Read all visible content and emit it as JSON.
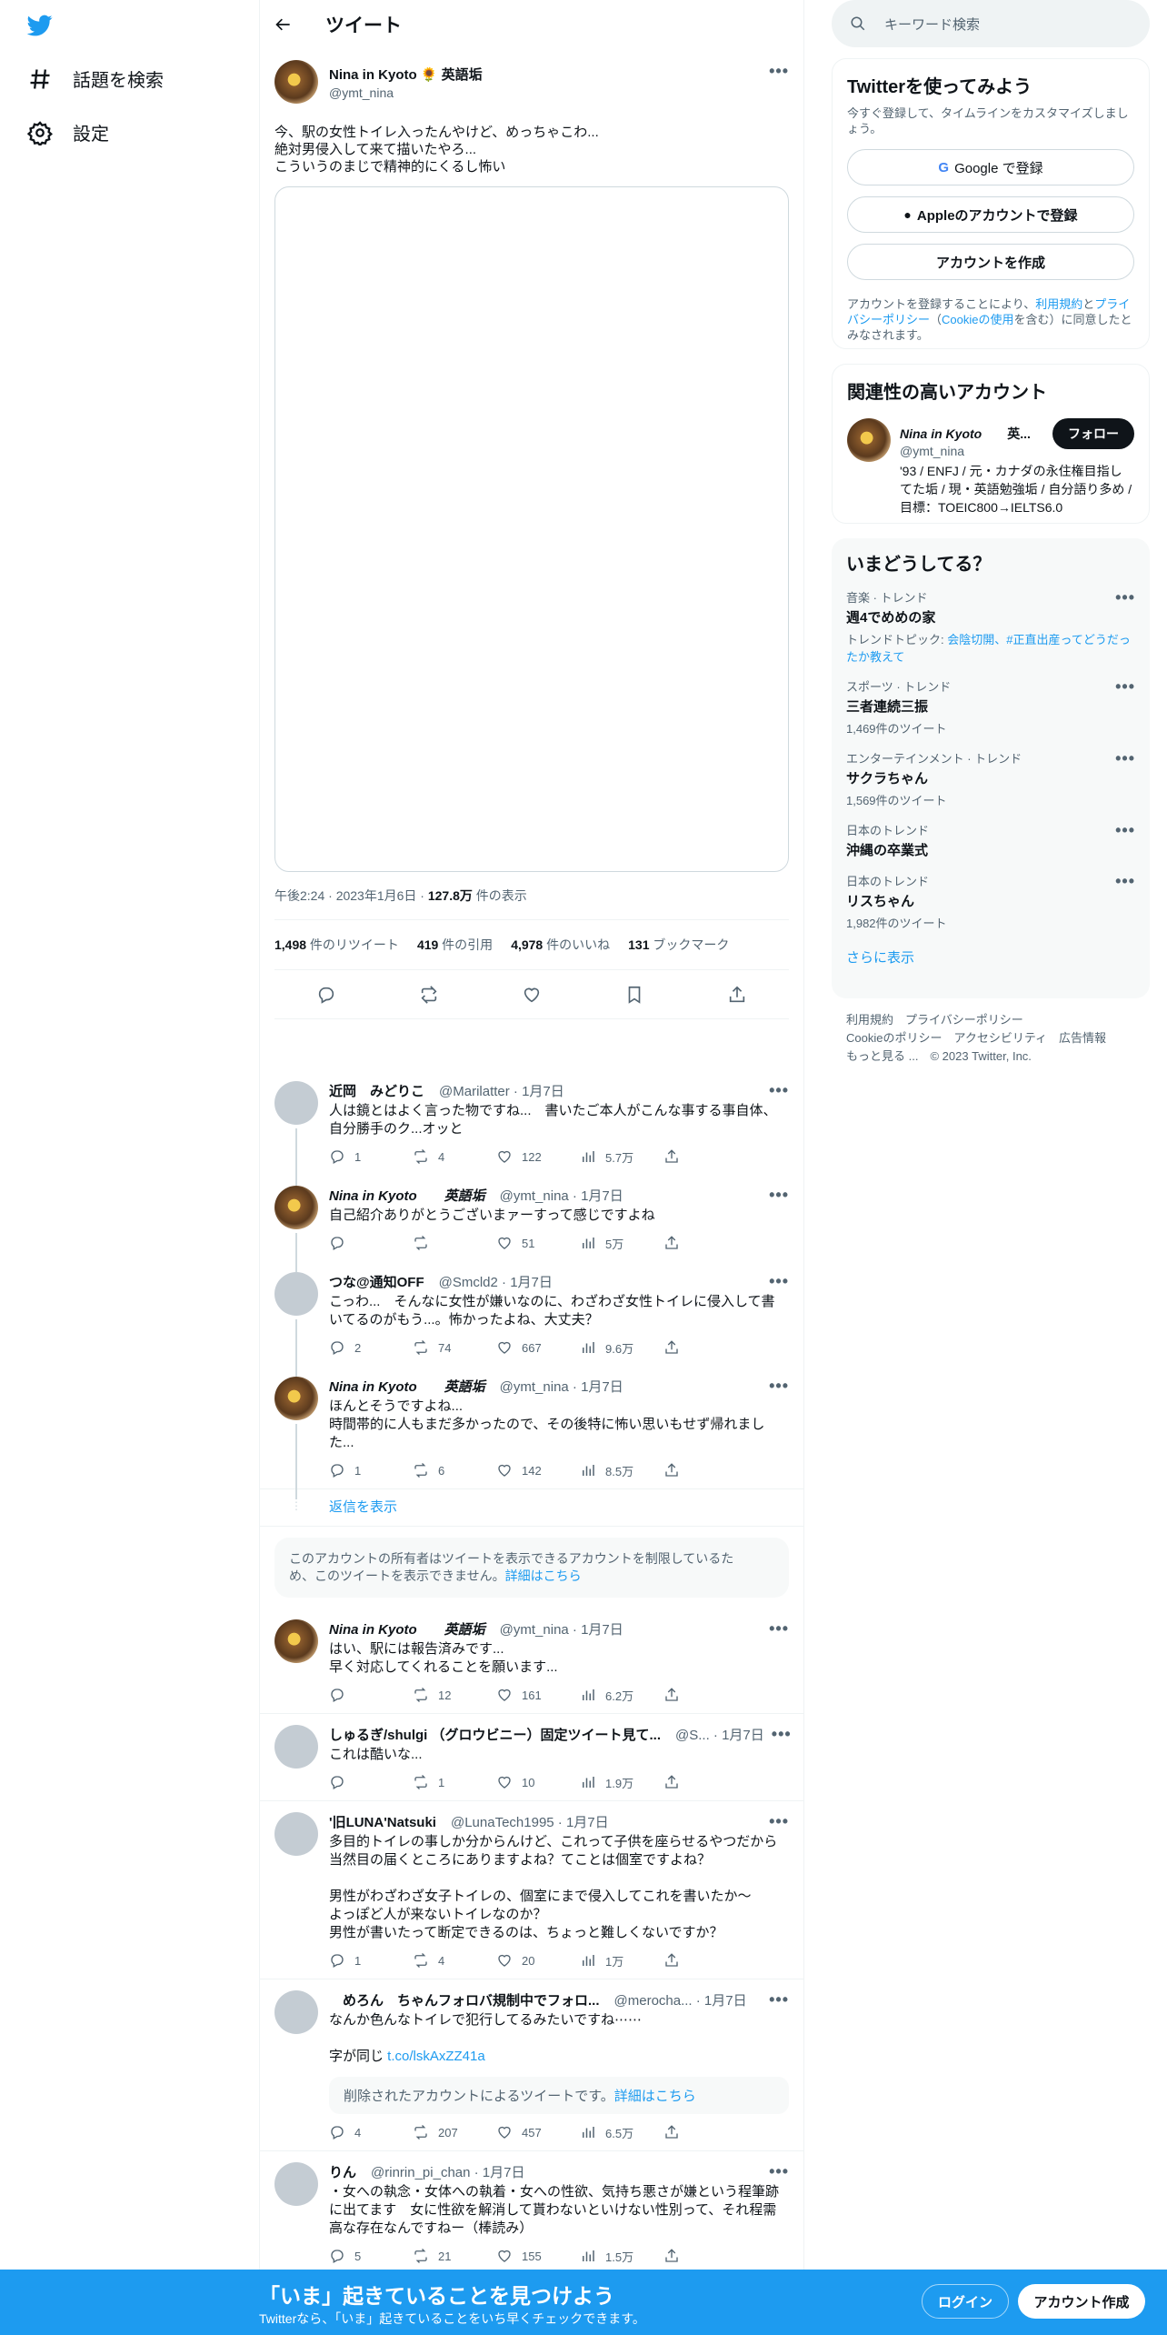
{
  "nav": {
    "explore": "話題を検索",
    "settings": "設定"
  },
  "header": {
    "title": "ツイート"
  },
  "tweet": {
    "name": "Nina in Kyoto 🌻 英語垢",
    "handle": "@ymt_nina",
    "lines": [
      "今、駅の女性トイレ入ったんやけど、めっちゃこわ...",
      "絶対男侵入して来て描いたやろ...",
      "こういうのまじで精神的にくるし怖い"
    ],
    "time": "午後2:24 · 2023年1月6日 · ",
    "views": "127.8万",
    "views_label": " 件の表示",
    "stats": [
      {
        "n": "1,498",
        "l": " 件のリツイート"
      },
      {
        "n": "419",
        "l": " 件の引用"
      },
      {
        "n": "4,978",
        "l": " 件のいいね"
      },
      {
        "n": "131",
        "l": " ブックマーク"
      }
    ]
  },
  "replies": [
    {
      "name": "近岡　みどりこ",
      "handle": "@Marilatter · 1月7日",
      "text": [
        "人は鏡とはよく言った物ですね...　書いたご本人がこんな事する事自体、",
        "自分勝手のク...オッと"
      ],
      "c": "1",
      "r": "4",
      "l": "122",
      "v": "5.7万"
    },
    {
      "name": "Nina in Kyoto　　英語垢",
      "handle": "@ymt_nina · 1月7日",
      "text": [
        "自己紹介ありがとうございまァーすって感じですよね"
      ],
      "c": "",
      "r": "",
      "l": "51",
      "v": "5万"
    },
    {
      "name": "つな@通知OFF",
      "handle": "@Smcld2 · 1月7日",
      "text": [
        "こっわ...　そんなに女性が嫌いなのに、わざわざ女性トイレに侵入して書",
        "いてるのがもう...。怖かったよね、大丈夫？"
      ],
      "c": "2",
      "r": "74",
      "l": "667",
      "v": "9.6万"
    },
    {
      "name": "Nina in Kyoto　　英語垢",
      "handle": "@ymt_nina · 1月7日",
      "text": [
        "ほんとそうですよね...",
        "時間帯的に人もまだ多かったので、その後特に怖い思いもせず帰れまし",
        "た..."
      ],
      "c": "1",
      "r": "6",
      "l": "142",
      "v": "8.5万"
    }
  ],
  "show_replies": "返信を表示",
  "restricted": {
    "text": "このアカウントの所有者はツイートを表示できるアカウントを制限しているた",
    "text2": "め、このツイートを表示できません。",
    "link": "詳細はこちら"
  },
  "replies2": [
    {
      "name": "Nina in Kyoto　　英語垢",
      "handle": "@ymt_nina · 1月7日",
      "text": [
        "はい、駅には報告済みです...",
        "早く対応してくれることを願います..."
      ],
      "c": "",
      "r": "12",
      "l": "161",
      "v": "6.2万"
    },
    {
      "name": "しゅるぎ/shulgi （グロウビニー）固定ツイート見て...",
      "handle": "@S... · 1月7日",
      "text": [
        "これは酷いな..."
      ],
      "c": "",
      "r": "1",
      "l": "10",
      "v": "1.9万"
    },
    {
      "name": "'旧LUNA'Natsuki",
      "handle": "@LunaTech1995 · 1月7日",
      "text": [
        "多目的トイレの事しか分からんけど、これって子供を座らせるやつだから",
        "当然目の届くところにありますよね？てことは個室ですよね？",
        "",
        "男性がわざわざ女子トイレの、個室にまで侵入してこれを書いたか～",
        "よっぽど人が来ないトイレなのか？",
        "男性が書いたって断定できるのは、ちょっと難しくないですか？"
      ],
      "c": "1",
      "r": "4",
      "l": "20",
      "v": "1万"
    },
    {
      "name": "　めろん　ちゃんフォロバ規制中でフォロ...",
      "handle": "@merocha... · 1月7日",
      "text": [
        "なんか色んなトイレで犯行してるみたいですね⋯⋯",
        "",
        "字が同じ "
      ],
      "link": "t.co/lskAxZZ41a",
      "deleted": "削除されたアカウントによるツイートです。",
      "deleted_link": "詳細はこちら",
      "c": "4",
      "r": "207",
      "l": "457",
      "v": "6.5万"
    },
    {
      "name": "りん",
      "handle": "@rinrin_pi_chan · 1月7日",
      "text": [
        "・女への執念・女体への執着・女への性欲、気持ち悪さが嫌という程筆跡",
        "に出てます　女に性欲を解消して貰わないといけない性別って、それ程需",
        "高な存在なんですねー（棒読み）"
      ],
      "c": "5",
      "r": "21",
      "l": "155",
      "v": "1.5万"
    }
  ],
  "right": {
    "search": "キーワード検索",
    "signup_title": "Twitterを使ってみよう",
    "signup_sub": "今すぐ登録して、タイムラインをカスタマイズしましょう。",
    "google": "Google で登録",
    "apple": "Appleのアカウントで登録",
    "create": "アカウントを作成",
    "terms": [
      "アカウントを登録することにより、",
      "利用規約",
      "と",
      "プライバシーポリシー",
      "（",
      "Cookieの使用",
      "を含む）に同意したとみなされます。"
    ],
    "related_title": "関連性の高いアカウント",
    "rel_name": "Nina in Kyoto",
    "rel_name2": "英...",
    "rel_handle": "@ymt_nina",
    "follow": "フォロー",
    "rel_bio": "'93 / ENFJ / 元・カナダの永住権目指してた垢 / 現・英語勉強垢 / 自分語り多め / 目標：TOEIC800→IELTS6.0",
    "trends_title": "いまどうしてる？",
    "trends": [
      {
        "c": "音楽 · トレンド",
        "n": "週4でめめの家",
        "s": "トレンドトピック: ",
        "s_links": "会陰切開、#正直出産ってどうだったか教えて"
      },
      {
        "c": "スポーツ · トレンド",
        "n": "三者連続三振",
        "s": "1,469件のツイート"
      },
      {
        "c": "エンターテインメント · トレンド",
        "n": "サクラちゃん",
        "s": "1,569件のツイート"
      },
      {
        "c": "日本のトレンド",
        "n": "沖縄の卒業式",
        "s": ""
      },
      {
        "c": "日本のトレンド",
        "n": "リスちゃん",
        "s": "1,982件のツイート"
      }
    ],
    "show_more": "さらに表示",
    "footer": [
      "利用規約　プライバシーポリシー",
      "Cookieのポリシー　アクセシビリティ　広告情報",
      "もっと見る ...　© 2023 Twitter, Inc."
    ]
  },
  "banner": {
    "title": "「いま」起きていることを見つけよう",
    "sub": "Twitterなら、「いま」起きていることをいち早くチェックできます。",
    "login": "ログイン",
    "signup": "アカウント作成"
  }
}
